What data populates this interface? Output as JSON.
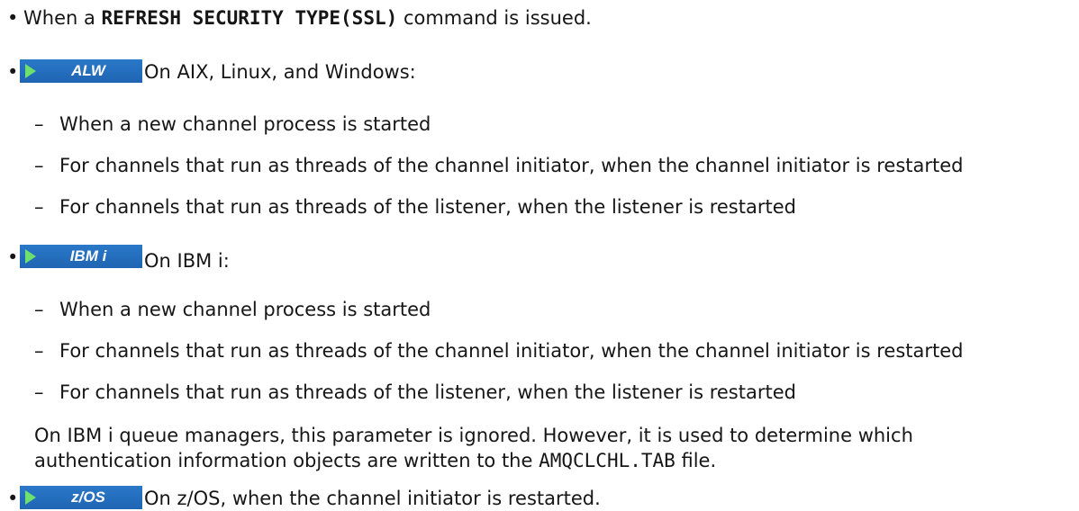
{
  "bullet_char": "•",
  "dash_char": "–",
  "refresh": {
    "prefix": "When a ",
    "command": "REFRESH SECURITY TYPE(SSL)",
    "suffix": " command is issued."
  },
  "alw": {
    "badge": "ALW",
    "text": "On AIX, Linux, and Windows:",
    "items": [
      "When a new channel process is started",
      "For channels that run as threads of the channel initiator, when the channel initiator is restarted",
      "For channels that run as threads of the listener, when the listener is restarted"
    ]
  },
  "ibmi": {
    "badge": "IBM i",
    "text": "On IBM i:",
    "items": [
      "When a new channel process is started",
      "For channels that run as threads of the channel initiator, when the channel initiator is restarted",
      "For channels that run as threads of the listener, when the listener is restarted"
    ],
    "note_line1": "On IBM i queue managers, this parameter is ignored. However, it is used to determine which",
    "note_line2_prefix": "authentication information objects are written to the ",
    "note_file": "AMQCLCHL.TAB",
    "note_line2_suffix": " file."
  },
  "zos": {
    "badge": "z/OS",
    "text": "On z/OS, when the channel initiator is restarted."
  },
  "colors": {
    "badge_blue": "#1f65b3",
    "badge_arrow": "#6ee06e",
    "text": "#161616"
  }
}
